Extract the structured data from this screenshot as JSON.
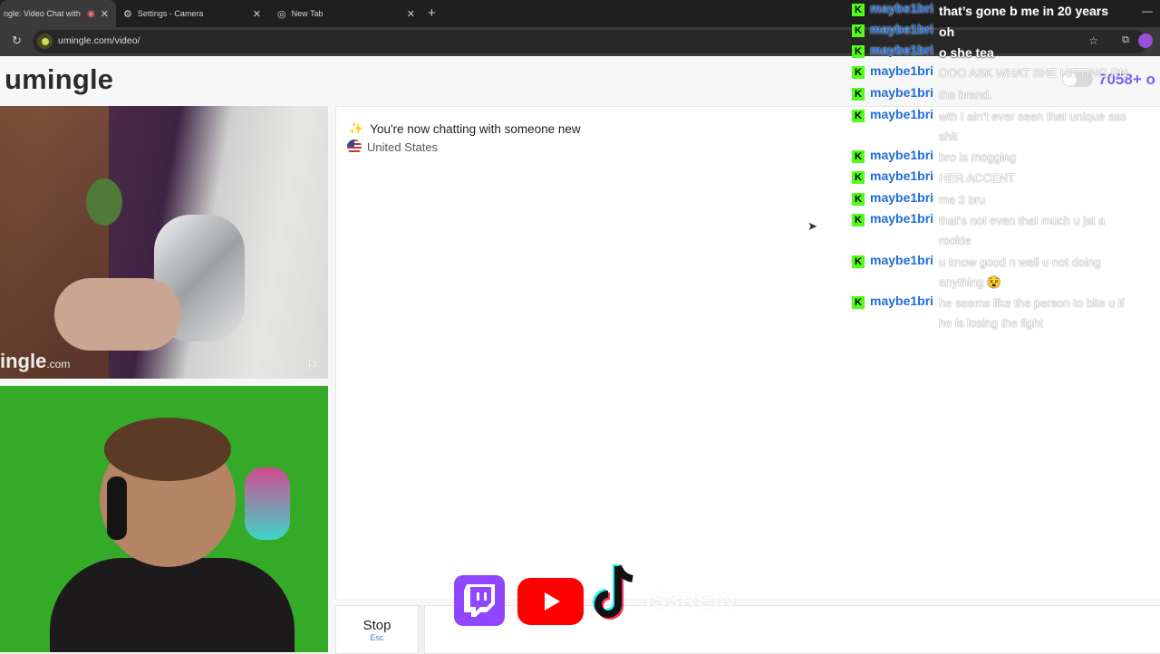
{
  "browser": {
    "tabs": [
      {
        "title": "ngle: Video Chat with S",
        "active": true
      },
      {
        "title": "Settings - Camera",
        "active": false
      },
      {
        "title": "New Tab",
        "active": false
      }
    ],
    "url": "umingle.com/video/"
  },
  "site": {
    "logo": "umingle",
    "online_count": "7058+ o",
    "watermark": "ingle",
    "watermark_suffix": ".com"
  },
  "chat": {
    "status_message": "You're now chatting with someone new",
    "country": "United States",
    "stop_label": "Stop",
    "stop_shortcut": "Esc"
  },
  "stream_chat": [
    {
      "user": "maybe1bri",
      "text": "that’s gone b me in 20 years",
      "style": "bright"
    },
    {
      "user": "maybe1bri",
      "text": "oh",
      "style": "bright"
    },
    {
      "user": "maybe1bri",
      "text": "o she tea",
      "style": "bright"
    },
    {
      "user": "maybe1bri",
      "text": "OOO ASK WHAT SHE HITTING RN",
      "style": "faint"
    },
    {
      "user": "maybe1bri",
      "text": "the brand.",
      "style": "faint"
    },
    {
      "user": "maybe1bri",
      "text": "wth I ain't ever seen that unique ass shit",
      "style": "faint"
    },
    {
      "user": "maybe1bri",
      "text": "bro is mogging",
      "style": "faint"
    },
    {
      "user": "maybe1bri",
      "text": "HER ACCENT",
      "style": "faint"
    },
    {
      "user": "maybe1bri",
      "text": "me 3 bru",
      "style": "faint"
    },
    {
      "user": "maybe1bri",
      "text": "that's not even that much u jst a rookie",
      "style": "faint"
    },
    {
      "user": "maybe1bri",
      "text": "u know good n well u not doing anything 😵",
      "style": "faint"
    },
    {
      "user": "maybe1bri",
      "text": "he seems like the person to bite u if he is losing the fight",
      "style": "faint"
    }
  ],
  "overlay": {
    "handle": "IS3REIN"
  }
}
